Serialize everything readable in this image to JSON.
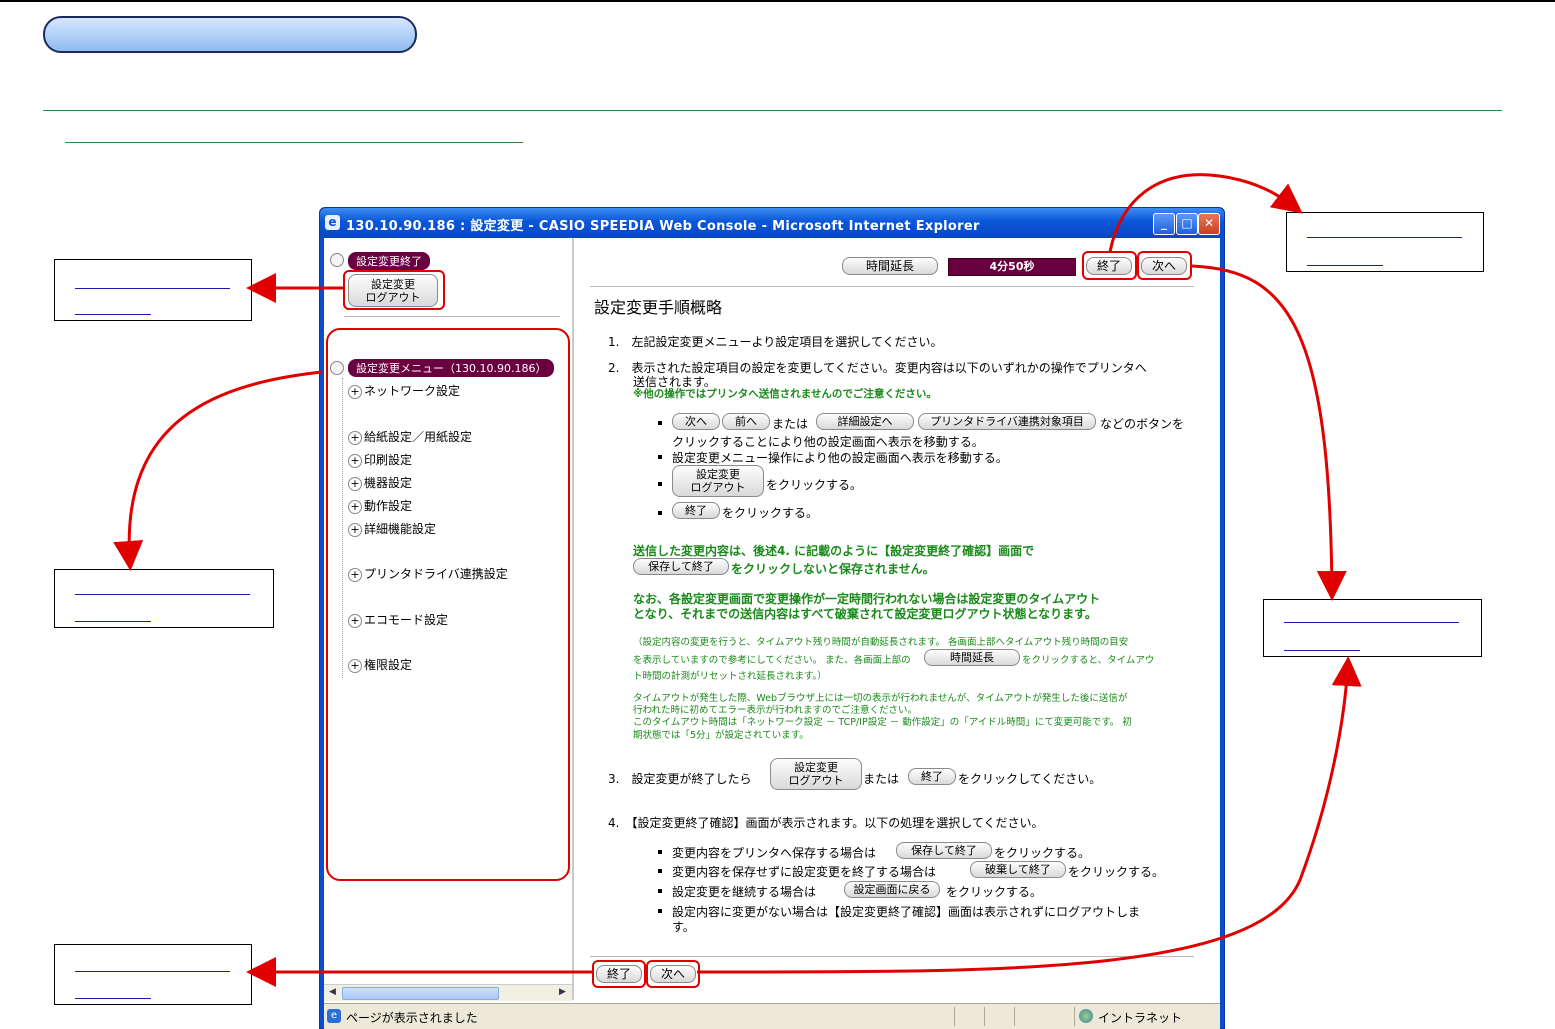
{
  "window": {
    "title": "130.10.90.186 : 設定変更 - CASIO SPEEDIA Web Console - Microsoft Internet Explorer",
    "ie_icon": "ie-logo-icon"
  },
  "left_pane": {
    "section_end_label": "設定変更終了",
    "logout_button": [
      "設定変更",
      "ログアウト"
    ],
    "menu_label": "設定変更メニュー（130.10.90.186）",
    "menu_items": [
      "ネットワーク設定",
      "給紙設定／用紙設定",
      "印刷設定",
      "機器設定",
      "動作設定",
      "詳細機能設定",
      "プリンタドライバ連携設定",
      "エコモード設定",
      "権限設定"
    ]
  },
  "header": {
    "extend_button": "時間延長",
    "timer": "4分50秒",
    "end_button": "終了",
    "next_button": "次へ"
  },
  "content": {
    "title": "設定変更手順概略",
    "step1": "1.　左記設定変更メニューより設定項目を選択してください。",
    "step2_line1": "2.　表示された設定項目の設定を変更してください。変更内容は以下のいずれかの操作でプリンタへ",
    "step2_line2": "送信されます。",
    "step2_note": "※他の操作ではプリンタへ送信されませんのでご注意ください。",
    "bullet1_btn_next": "次へ",
    "bullet1_btn_prev": "前へ",
    "bullet1_or": "または",
    "bullet1_btn_detail": "詳細設定へ",
    "bullet1_btn_driver": "プリンタドライバ連携対象項目",
    "bullet1_text1": "などのボタンを",
    "bullet1_text2": "クリックすることにより他の設定画面へ表示を移動する。",
    "bullet2": "設定変更メニュー操作により他の設定画面へ表示を移動する。",
    "bullet3_btn": [
      "設定変更",
      "ログアウト"
    ],
    "bullet3_text": "をクリックする。",
    "bullet4_btn": "終了",
    "bullet4_text": "をクリックする。",
    "green1_line1": "送信した変更内容は、後述4. に記載のように【設定変更終了確認】画面で",
    "green1_btn": "保存して終了",
    "green1_line2": "をクリックしないと保存されません。",
    "green2_line1": "なお、各設定変更画面で変更操作が一定時間行われない場合は設定変更のタイムアウト",
    "green2_line2": "となり、それまでの送信内容はすべて破棄されて設定変更ログアウト状態となります。",
    "small1_line1": "（設定内容の変更を行うと、タイムアウト残り時間が自動延長されます。 各画面上部へタイムアウト残り時間の目安",
    "small1_line2a": "を表示していますので参考にしてください。 また、各画面上部の",
    "small1_btn": "時間延長",
    "small1_line2b": "をクリックすると、タイムアウ",
    "small1_line3": "ト時間の計測がリセットされ延長されます。）",
    "small2_line1": "タイムアウトが発生した際、Webブラウザ上には一切の表示が行われませんが、タイムアウトが発生した後に送信が",
    "small2_line2": "行われた時に初めてエラー表示が行われますのでご注意ください。",
    "small2_line3": "このタイムアウト時間は「ネットワーク設定 － TCP/IP設定 － 動作設定」の「アイドル時間」にて変更可能です。 初",
    "small2_line4": "期状態では「5分」が設定されています。",
    "step3_prefix": "3.　設定変更が終了したら",
    "step3_btn": [
      "設定変更",
      "ログアウト"
    ],
    "step3_or": "または",
    "step3_btn_end": "終了",
    "step3_suffix": "をクリックしてください。",
    "step4": "4.　【設定変更終了確認】画面が表示されます。以下の処理を選択してください。",
    "s4b1_prefix": "変更内容をプリンタへ保存する場合は",
    "s4b1_btn": "保存して終了",
    "s4b1_suffix": "をクリックする。",
    "s4b2_prefix": "変更内容を保存せずに設定変更を終了する場合は",
    "s4b2_btn": "破棄して終了",
    "s4b2_suffix": "をクリックする。",
    "s4b3_prefix": "設定変更を継続する場合は",
    "s4b3_btn": "設定画面に戻る",
    "s4b3_suffix": "をクリックする。",
    "s4b4_line1": "設定内容に変更がない場合は【設定変更終了確認】画面は表示されずにログアウトしま",
    "s4b4_line2": "す。"
  },
  "footer": {
    "end_button": "終了",
    "next_button": "次へ"
  },
  "statusbar": {
    "text": "ページが表示されました",
    "zone": "イントラネット"
  },
  "colors": {
    "annotation_red": "#e00000",
    "menu_label_bg": "#6a0040",
    "timer_bg": "#6a0040",
    "note_green": "#1a8a1a",
    "title_bar_blue": "#0a56d8"
  }
}
